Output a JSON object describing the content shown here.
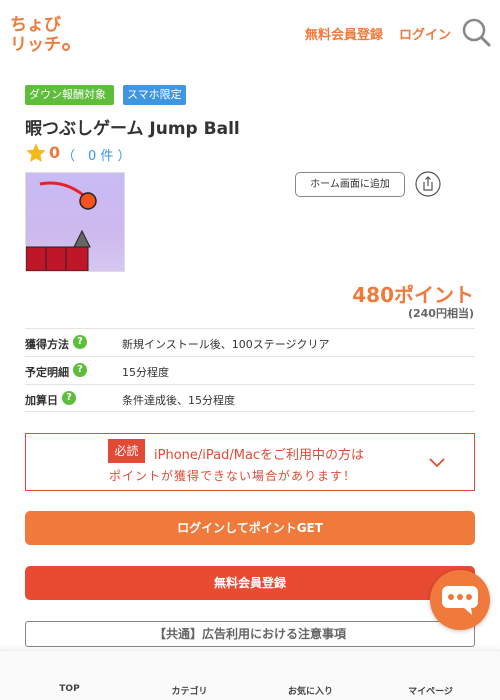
{
  "header": {
    "logo_text": "ちょびリッチ。",
    "register_label": "無料会員登録",
    "login_label": "ログイン"
  },
  "badges": [
    "ダウン報酬対象",
    "スマホ限定"
  ],
  "offer": {
    "title": "暇つぶしゲーム Jump Ball",
    "rating_score": "0",
    "rating_count": "（　0 件 ）",
    "home_button": "ホーム画面に追加",
    "points": "480ポイント",
    "points_yen": "(240円相当)"
  },
  "info": [
    {
      "label": "獲得方法",
      "value": "新規インストール後、100ステージクリア"
    },
    {
      "label": "予定明細",
      "value": "15分程度"
    },
    {
      "label": "加算日",
      "value": "条件達成後、15分程度"
    }
  ],
  "notice": {
    "tag": "必読",
    "line1": "iPhone/iPad/Macをご利用中の方は",
    "line2": "ポイントが獲得できない場合があります！"
  },
  "buttons": {
    "login_get": "ログインしてポイントGET",
    "register": "無料会員登録",
    "caution": "【共通】広告利用における注意事項"
  },
  "bottom_nav": [
    "TOP",
    "カテゴリ",
    "お気に入り",
    "マイページ"
  ],
  "colors": {
    "accent_orange": "#f07a3c",
    "red": "#e84a32",
    "green_badge": "#5ebd3a",
    "blue_badge": "#3e95e0"
  },
  "icons": [
    "search-icon",
    "star-icon",
    "share-icon",
    "help-icon",
    "chevron-down-icon",
    "chat-icon"
  ]
}
